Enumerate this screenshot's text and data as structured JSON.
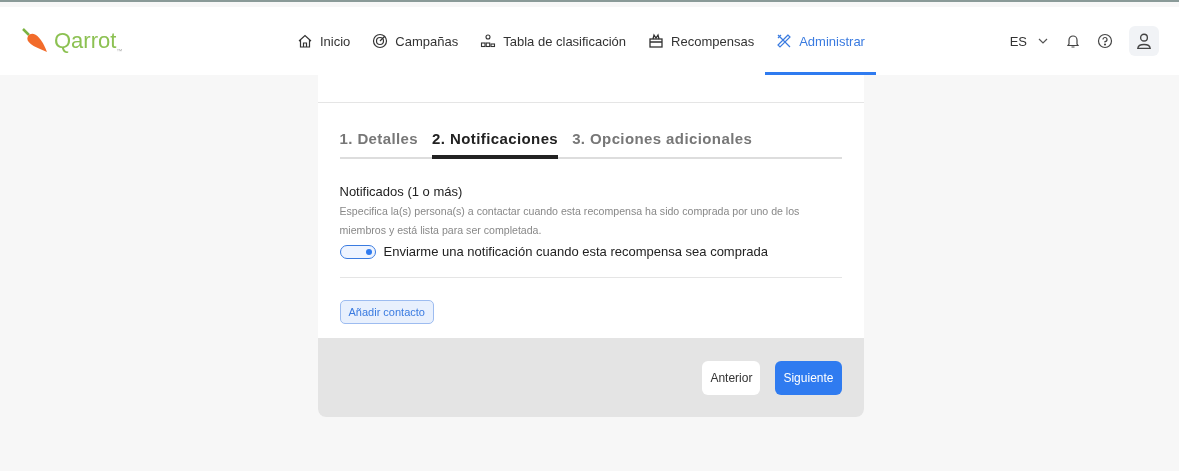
{
  "logo": {
    "name": "Qarrot",
    "mark": "™"
  },
  "nav": [
    {
      "label": "Inicio",
      "kind": "home",
      "selected": false
    },
    {
      "label": "Campañas",
      "kind": "campaign",
      "selected": false
    },
    {
      "label": "Tabla de clasificación",
      "kind": "ranking",
      "selected": false
    },
    {
      "label": "Recompensas",
      "kind": "rewards",
      "selected": false
    },
    {
      "label": "Administrar",
      "kind": "admin",
      "selected": true
    }
  ],
  "language": "ES",
  "steps": [
    {
      "label": "1. Detalles",
      "selected": false
    },
    {
      "label": "2. Notificaciones",
      "selected": true
    },
    {
      "label": "3. Opciones adicionales",
      "selected": false
    }
  ],
  "section": {
    "title": "Notificados (1 o más)",
    "description": "Especifica la(s) persona(s) a contactar cuando esta recompensa ha sido comprada por uno de los miembros y está lista para ser completada.",
    "toggle": {
      "label": "Enviarme una notificación cuando esta recompensa sea comprada",
      "on": true
    },
    "add_button": "Añadir contacto"
  },
  "footer": {
    "back": "Anterior",
    "next": "Siguiente"
  }
}
